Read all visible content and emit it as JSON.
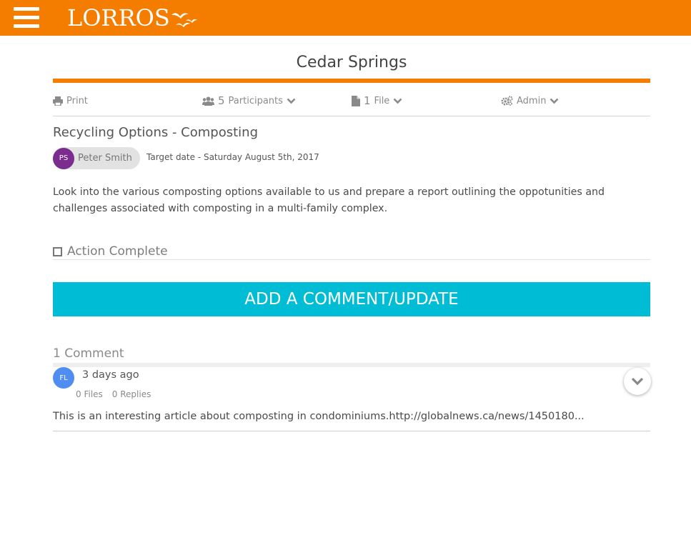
{
  "brand": {
    "logo_text": "LORROS",
    "bar_color": "#f47d00"
  },
  "page": {
    "title": "Cedar Springs"
  },
  "toolbar": {
    "print_label": "Print",
    "participants_count": "5",
    "participants_label": "Participants",
    "files_count": "1",
    "files_label": "File",
    "admin_label": "Admin"
  },
  "action": {
    "title": "Recycling Options - Composting",
    "owner_initials": "PS",
    "owner_name": "Peter Smith",
    "target_date": "Target date - Saturday August 5th, 2017",
    "description": "Look into the various composting options available to us and prepare a report outlining the oppotunities and challenges associated with composting in a multi-family complex.",
    "complete_label": "Action Complete"
  },
  "comment_button": {
    "label": "ADD A COMMENT/UPDATE",
    "color": "#00bcd4"
  },
  "comments": {
    "count_label": "1 Comment",
    "items": [
      {
        "initials": "FL",
        "time": "3 days ago",
        "files": "0 Files",
        "replies": "0 Replies",
        "text": "This is an interesting article about composting in condominiums.http://globalnews.ca/news/1450180..."
      }
    ]
  },
  "icons": [
    "menu-icon",
    "print-icon",
    "users-icon",
    "file-icon",
    "gears-icon",
    "chevron-down-icon",
    "checkbox-icon"
  ]
}
